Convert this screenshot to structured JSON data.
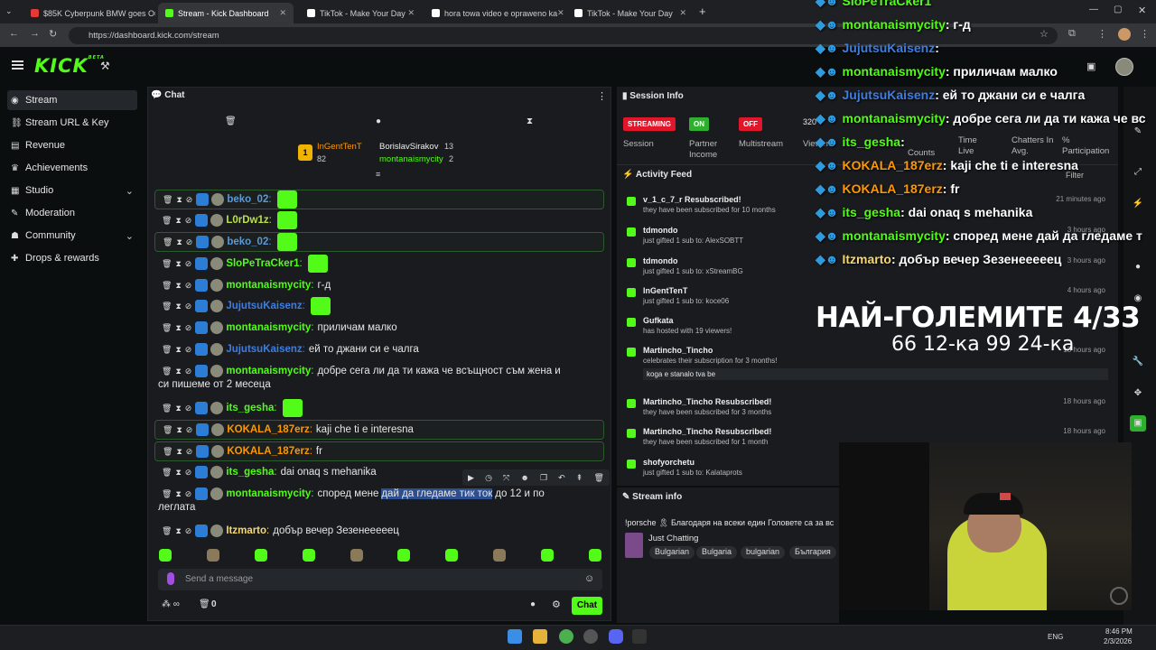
{
  "browser": {
    "tabs": [
      {
        "label": "$85K Cyberpunk BMW goes Ou",
        "color": "#e53935"
      },
      {
        "label": "Stream - Kick Dashboard",
        "color": "#53fc18"
      },
      {
        "label": "TikTok - Make Your Day",
        "color": "#ffffff"
      },
      {
        "label": "hora towa video e opraweno ka",
        "color": "#ffffff"
      },
      {
        "label": "TikTok - Make Your Day",
        "color": "#ffffff"
      }
    ],
    "url": "https://dashboard.kick.com/stream"
  },
  "app": {
    "logo": "KICK",
    "logo_sup": "BETA"
  },
  "sidebar": {
    "items": [
      {
        "label": "Stream",
        "icon": "wifi-icon",
        "active": true
      },
      {
        "label": "Stream URL & Key",
        "icon": "link-icon"
      },
      {
        "label": "Revenue",
        "icon": "chart-icon"
      },
      {
        "label": "Achievements",
        "icon": "trophy-icon"
      },
      {
        "label": "Studio",
        "icon": "grid-icon",
        "chevron": true
      },
      {
        "label": "Moderation",
        "icon": "wrench-icon"
      },
      {
        "label": "Community",
        "icon": "users-icon",
        "chevron": true
      },
      {
        "label": "Drops & rewards",
        "icon": "gift-icon"
      }
    ]
  },
  "chat": {
    "title": "Chat",
    "leaderboard": {
      "first": "InGentTenT",
      "first_count": "82",
      "second": "BorislavSirakov",
      "second_count": "13",
      "third": "montanaismycity",
      "third_count": "2"
    },
    "messages": [
      {
        "user": "beko_02",
        "text": "",
        "color": "#5a9ad6",
        "hl": true
      },
      {
        "user": "L0rDw1z",
        "text": "",
        "color": "#b9e04a"
      },
      {
        "user": "beko_02",
        "text": "",
        "color": "#5a9ad6",
        "hl": true
      },
      {
        "user": "SloPeTraCker1",
        "text": "",
        "color": "#53fc18"
      },
      {
        "user": "montanaismycity",
        "text": "г-д",
        "color": "#53fc18"
      },
      {
        "user": "JujutsuKaisenz",
        "text": "",
        "color": "#3d7ee0"
      },
      {
        "user": "montanaismycity",
        "text": "приличам малко",
        "color": "#53fc18"
      },
      {
        "user": "JujutsuKaisenz",
        "text": "ей то джани си е чалга",
        "color": "#3d7ee0"
      },
      {
        "user": "montanaismycity",
        "text": "добре сега ли да ти кажа че всъщност съм жена и",
        "text2": "си пишеме от 2 месеца",
        "color": "#53fc18"
      },
      {
        "user": "its_gesha",
        "text": "",
        "color": "#53fc18"
      },
      {
        "user": "KOKALA_187erz",
        "text": "kaji che ti e interesna",
        "color": "#ff9800",
        "hl": true
      },
      {
        "user": "KOKALA_187erz",
        "text": "fr",
        "color": "#ff9800",
        "hl": true
      },
      {
        "user": "its_gesha",
        "text": "dai onaq s mehanika",
        "color": "#53fc18"
      },
      {
        "user": "montanaismycity",
        "text_a": "според мене",
        "text_sel": "дай да гледаме тик ток",
        "text_b": "до 12 и по",
        "text2": "леглата",
        "color": "#53fc18"
      },
      {
        "user": "Itzmarto",
        "text": "добър вечер Зезенееееец",
        "color": "#f5d76e"
      }
    ],
    "input_placeholder": "Send a message",
    "count": "0",
    "send_label": "Chat"
  },
  "session": {
    "title": "Session Info",
    "streaming": "STREAMING",
    "partner": "ON",
    "multistream": "OFF",
    "labels": [
      "Session",
      "Partner Income",
      "Multistream",
      "Viewers",
      "Counts",
      "Time Live",
      "Chatters In Avg.",
      "% Participation"
    ],
    "viewers": "320"
  },
  "activity": {
    "title": "Activity Feed",
    "filter": "Filter",
    "items": [
      {
        "title": "v_1_c_7_r Resubscribed!",
        "sub": "they have been subscribed for 10 months",
        "time": "21 minutes ago"
      },
      {
        "title": "tdmondo",
        "sub": "just gifted 1 sub to: AlexSOBTT",
        "time": "3 hours ago"
      },
      {
        "title": "tdmondo",
        "sub": "just gifted 1 sub to: xStreamBG",
        "time": "3 hours ago"
      },
      {
        "title": "InGentTenT",
        "sub": "just gifted 1 sub to: koce06",
        "time": "4 hours ago"
      },
      {
        "title": "Gufkata",
        "sub": "has hosted with 19 viewers!",
        "time": ""
      },
      {
        "title": "Martincho_Tincho",
        "sub": "celebrates their subscription for 3 months!",
        "msg": "koga e stanalo tva be",
        "time": "13 hours ago"
      },
      {
        "title": "Martincho_Tincho Resubscribed!",
        "sub": "they have been subscribed for 3 months",
        "time": "18 hours ago"
      },
      {
        "title": "Martincho_Tincho Resubscribed!",
        "sub": "they have been subscribed for 1 month",
        "time": "18 hours ago"
      },
      {
        "title": "shofyorchetu",
        "sub": "just gifted 1 sub to: Kalataprots",
        "time": ""
      }
    ]
  },
  "streaminfo": {
    "title": "Stream info",
    "text": "!porsche 🎗 Благодаря на всеки един Головете са за вс",
    "category": "Just Chatting",
    "tags": [
      "Bulgarian",
      "Bulgaria",
      "bulgarian",
      "България"
    ]
  },
  "overlay": {
    "lines": [
      {
        "user": "SloPeTraCker1",
        "text": "",
        "color": "#53fc18"
      },
      {
        "user": "montanaismycity",
        "text": ": г-д",
        "color": "#53fc18"
      },
      {
        "user": "JujutsuKaisenz",
        "text": ":",
        "color": "#3d7ee0"
      },
      {
        "user": "montanaismycity",
        "text": ": приличам малко",
        "color": "#53fc18"
      },
      {
        "user": "JujutsuKaisenz",
        "text": ": ей то джани си е чалга",
        "color": "#3d7ee0"
      },
      {
        "user": "montanaismycity",
        "text": ": добре сега ли да ти кажа че вс",
        "color": "#53fc18"
      },
      {
        "user": "its_gesha",
        "text": ":",
        "color": "#53fc18"
      },
      {
        "user": "KOKALA_187erz",
        "text": ": kaji che ti e interesna",
        "color": "#ff9800"
      },
      {
        "user": "KOKALA_187erz",
        "text": ": fr",
        "color": "#ff9800"
      },
      {
        "user": "its_gesha",
        "text": ": dai onaq s mehanika",
        "color": "#53fc18"
      },
      {
        "user": "montanaismycity",
        "text": ": според мене дай да гледаме т",
        "color": "#53fc18"
      },
      {
        "user": "Itzmarto",
        "text": ": добър вечер Зезенееееец",
        "color": "#f5d76e"
      }
    ],
    "title": "НАЙ-ГОЛЕМИТЕ 4/33",
    "subtitle": "66 12-ка 99 24-ка"
  },
  "taskbar": {
    "lang": "ENG",
    "time": "8:46 PM",
    "date": "2/3/2026"
  }
}
